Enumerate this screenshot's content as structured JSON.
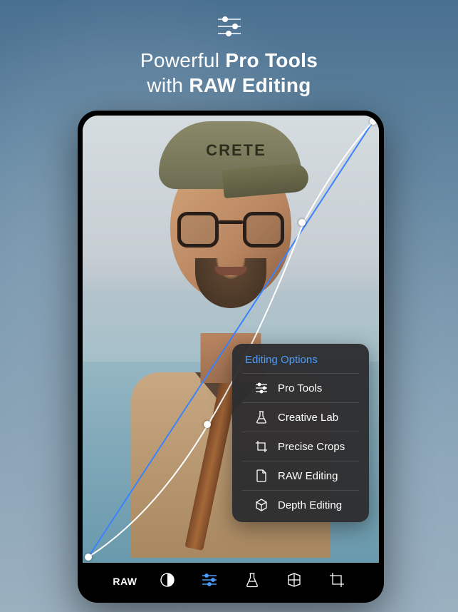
{
  "headline": {
    "line1_regular": "Powerful ",
    "line1_bold": "Pro Tools",
    "line2_regular": "with ",
    "line2_bold": "RAW Editing"
  },
  "cap_text": "CRETE",
  "popup": {
    "title": "Editing Options",
    "items": [
      {
        "label": "Pro Tools",
        "icon": "sliders"
      },
      {
        "label": "Creative Lab",
        "icon": "flask"
      },
      {
        "label": "Precise Crops",
        "icon": "crop"
      },
      {
        "label": "RAW Editing",
        "icon": "file"
      },
      {
        "label": "Depth Editing",
        "icon": "cube"
      }
    ]
  },
  "toolbar": {
    "items": [
      {
        "id": "raw",
        "label": "RAW",
        "icon": "text"
      },
      {
        "id": "contrast",
        "icon": "half-circle"
      },
      {
        "id": "sliders",
        "icon": "sliders",
        "active": true
      },
      {
        "id": "flask",
        "icon": "flask"
      },
      {
        "id": "depth",
        "icon": "depth-grid"
      },
      {
        "id": "crop",
        "icon": "crop"
      }
    ]
  }
}
